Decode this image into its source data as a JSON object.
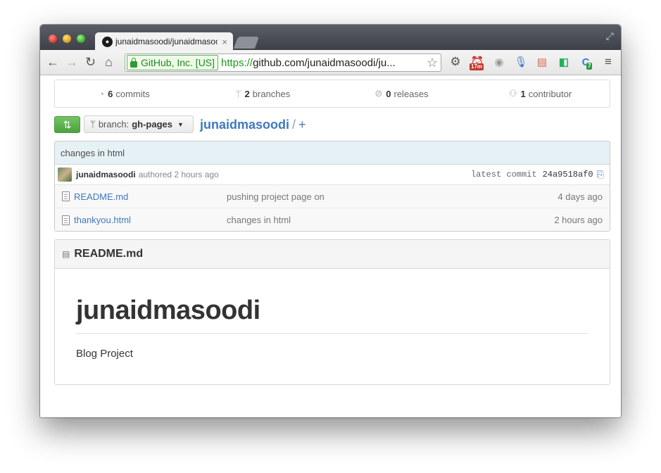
{
  "browser": {
    "tab_title": "junaidmasoodi/junaidmasoodi",
    "tab_close": "×",
    "ev_label": "GitHub, Inc. [US]",
    "url_scheme": "https://",
    "url_rest": "github.com/junaidmasoodi/ju...",
    "ext_badges": {
      "timer": "17m",
      "count": "7"
    }
  },
  "stats": {
    "commits": {
      "count": "6",
      "label": "commits"
    },
    "branches": {
      "count": "2",
      "label": "branches"
    },
    "releases": {
      "count": "0",
      "label": "releases"
    },
    "contributors": {
      "count": "1",
      "label": "contributor"
    }
  },
  "branch_selector": {
    "prefix": "branch:",
    "name": "gh-pages"
  },
  "repo": {
    "name": "junaidmasoodi",
    "sep": "/",
    "add": "+"
  },
  "latest_commit": {
    "message": "changes in html",
    "author": "junaidmasoodi",
    "authored": "authored 2 hours ago",
    "label": "latest commit",
    "sha": "24a9518af0"
  },
  "files": [
    {
      "name": "README.md",
      "message": "pushing project page on",
      "age": "4 days ago"
    },
    {
      "name": "thankyou.html",
      "message": "changes in html",
      "age": "2 hours ago"
    }
  ],
  "readme": {
    "filename": "README.md",
    "heading": "junaidmasoodi",
    "paragraph": "Blog Project"
  },
  "colors": {
    "link": "#4078c0",
    "green_button": "#55a846",
    "commit_bar": "#e6f1f6"
  }
}
